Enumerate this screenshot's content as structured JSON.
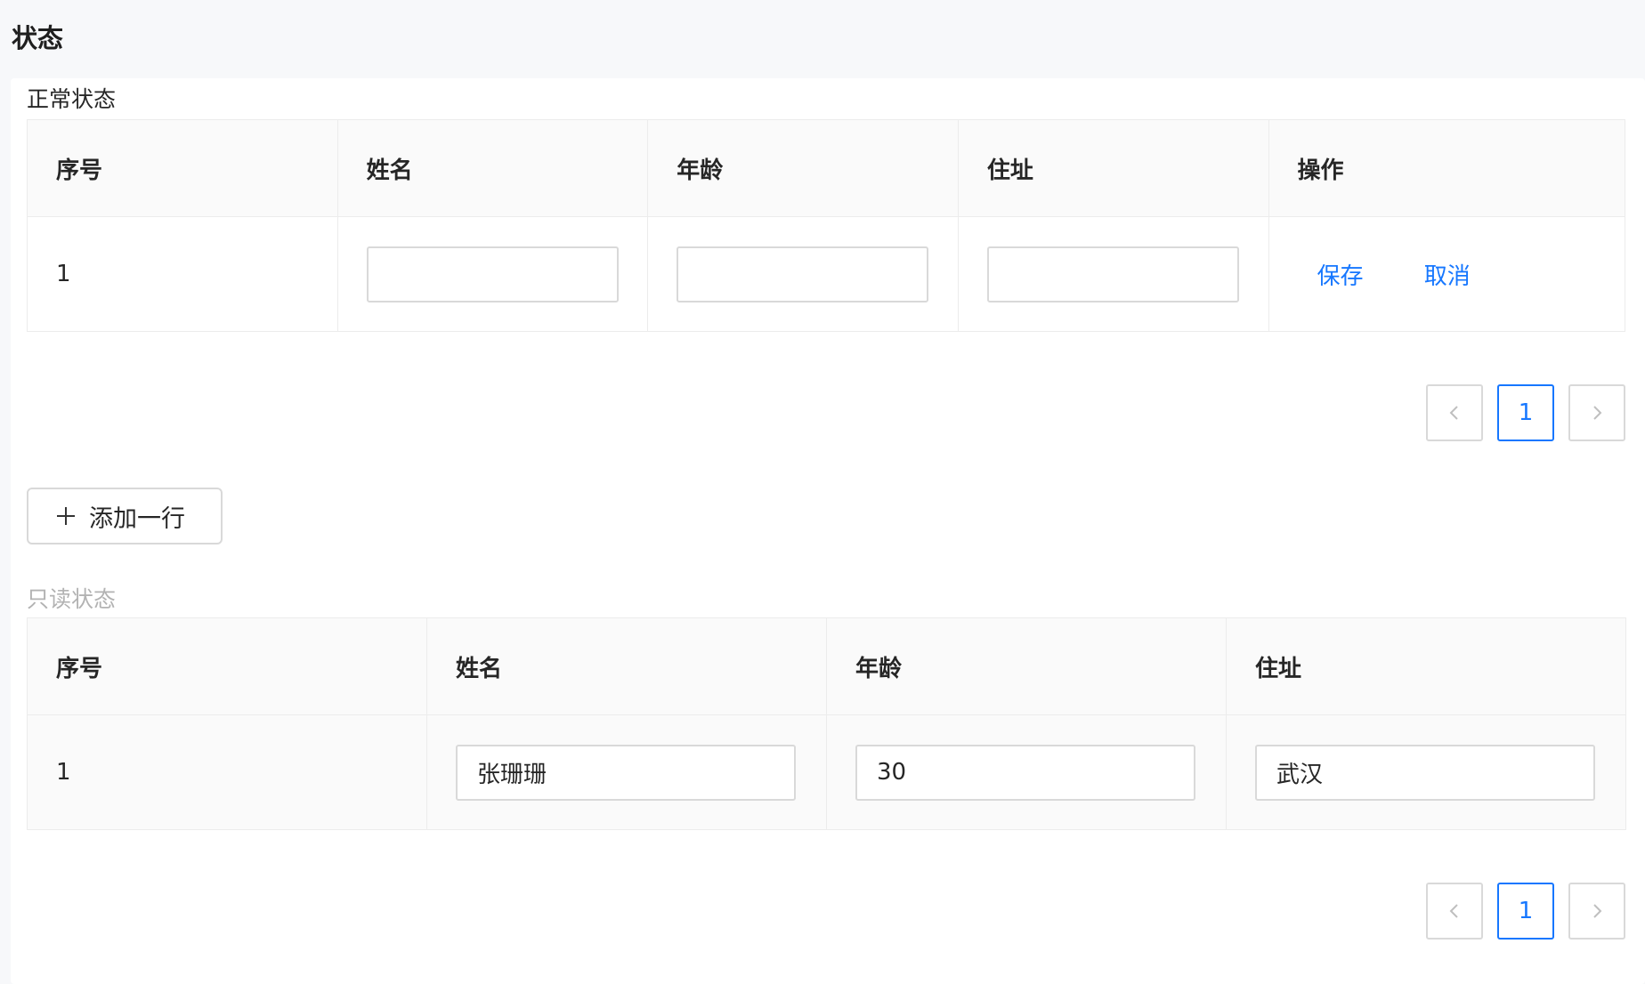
{
  "page": {
    "title": "状态"
  },
  "normal": {
    "label": "正常状态",
    "columns": [
      "序号",
      "姓名",
      "年龄",
      "住址",
      "操作"
    ],
    "row": {
      "index": "1",
      "name": "",
      "age": "",
      "address": ""
    },
    "actions": {
      "save": "保存",
      "cancel": "取消"
    },
    "pagination": {
      "current": "1"
    }
  },
  "add_row_button": {
    "label": "添加一行"
  },
  "readonly": {
    "label": "只读状态",
    "columns": [
      "序号",
      "姓名",
      "年龄",
      "住址"
    ],
    "row": {
      "index": "1",
      "name": "张珊珊",
      "age": "30",
      "address": "武汉"
    },
    "pagination": {
      "current": "1"
    }
  },
  "colors": {
    "accent": "#1677ff",
    "border": "#d9d9d9",
    "header_bg": "#fafafa"
  },
  "icons": {
    "prev": "chevron-left-icon",
    "next": "chevron-right-icon",
    "add": "plus-icon"
  }
}
